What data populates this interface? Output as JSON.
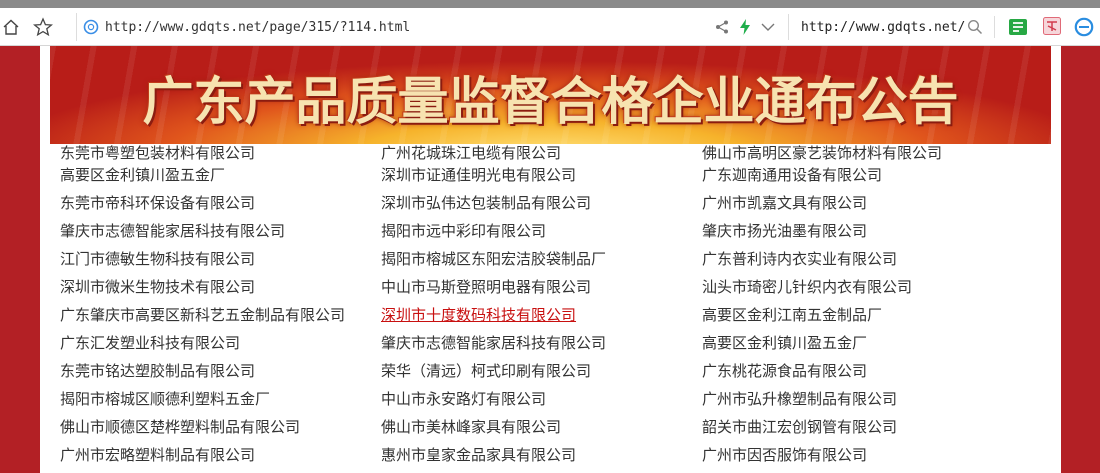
{
  "browser": {
    "url": "http://www.gdqts.net/page/315/?114.html",
    "search_text": "http://www.gdqts.net/"
  },
  "banner": {
    "title": "广东产品质量监督合格企业通布公告"
  },
  "columns": [
    [
      "东莞市粤塑包装材料有限公司",
      "高要区金利镇川盈五金厂",
      "东莞市帝科环保设备有限公司",
      "肇庆市志德智能家居科技有限公司",
      "江门市德敏生物科技有限公司",
      "深圳市微米生物技术有限公司",
      "广东肇庆市高要区新科艺五金制品有限公司",
      "广东汇发塑业科技有限公司",
      "东莞市铭达塑胶制品有限公司",
      "揭阳市榕城区顺德利塑料五金厂",
      "佛山市顺德区楚桦塑料制品有限公司",
      "广州市宏略塑料制品有限公司"
    ],
    [
      "广州花城珠江电缆有限公司",
      "深圳市证通佳明光电有限公司",
      "深圳市弘伟达包装制品有限公司",
      "揭阳市远中彩印有限公司",
      "揭阳市榕城区东阳宏洁胶袋制品厂",
      "中山市马斯登照明电器有限公司",
      "深圳市十度数码科技有限公司",
      "肇庆市志德智能家居科技有限公司",
      "荣华（清远）柯式印刷有限公司",
      "中山市永安路灯有限公司",
      "佛山市美林峰家具有限公司",
      "惠州市皇家金品家具有限公司"
    ],
    [
      "佛山市高明区豪艺装饰材料有限公司",
      "广东迦南通用设备有限公司",
      "广州市凯嘉文具有限公司",
      "肇庆市扬光油墨有限公司",
      "广东普利诗内衣实业有限公司",
      "汕头市琦密儿针织内衣有限公司",
      "高要区金利江南五金制品厂",
      "高要区金利镇川盈五金厂",
      "广东桃花源食品有限公司",
      "广州市弘升橡塑制品有限公司",
      "韶关市曲江宏创钢管有限公司",
      "广州市因否服饰有限公司"
    ]
  ],
  "highlight_color": "#c81010",
  "icons": [
    "home-icon",
    "star-icon",
    "globe-icon",
    "share-icon",
    "lightning-icon",
    "chevron-down-icon",
    "search-icon",
    "bookmark-extension-icon",
    "translate-extension-icon",
    "browser-extension-icon"
  ]
}
